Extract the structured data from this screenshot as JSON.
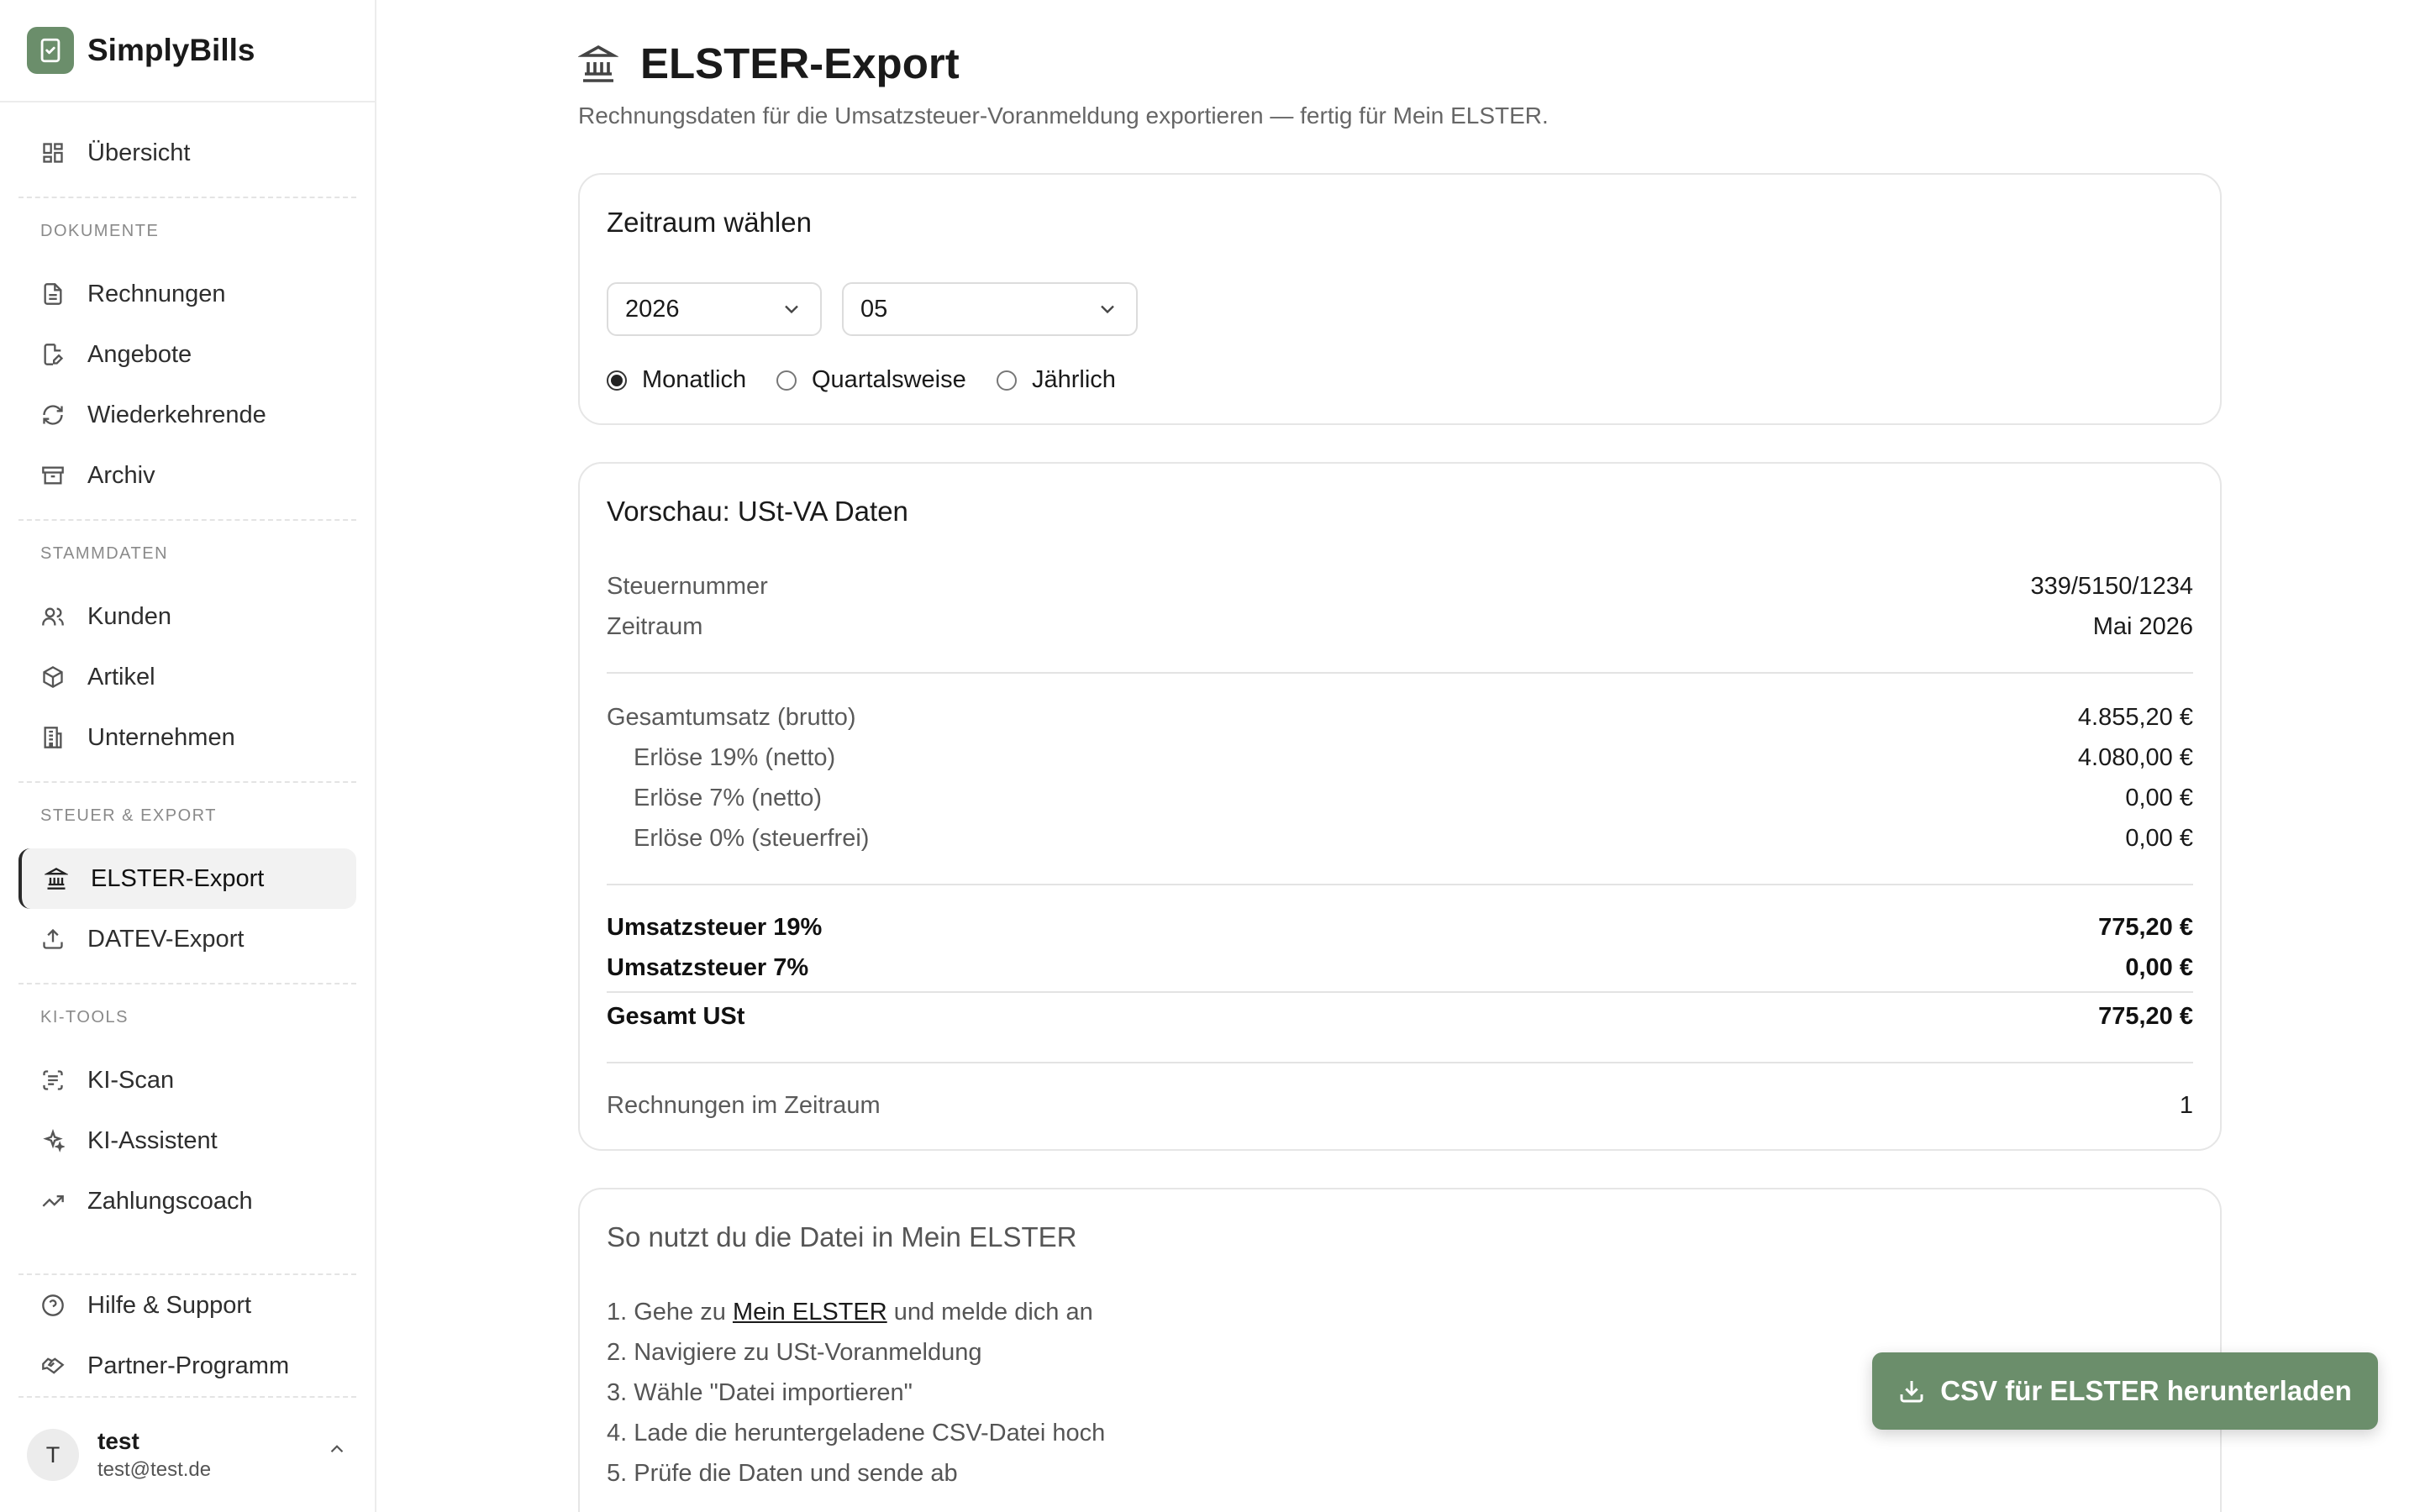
{
  "app": {
    "name": "SimplyBills"
  },
  "sidebar": {
    "overview": "Übersicht",
    "sections": {
      "documents": "DOKUMENTE",
      "masterdata": "STAMMDATEN",
      "tax": "STEUER & EXPORT",
      "ai": "KI-TOOLS"
    },
    "items": {
      "invoices": "Rechnungen",
      "offers": "Angebote",
      "recurring": "Wiederkehrende",
      "archive": "Archiv",
      "customers": "Kunden",
      "articles": "Artikel",
      "company": "Unternehmen",
      "elster": "ELSTER-Export",
      "datev": "DATEV-Export",
      "kiscan": "KI-Scan",
      "kiassistant": "KI-Assistent",
      "coach": "Zahlungscoach",
      "help": "Hilfe & Support",
      "partner": "Partner-Programm"
    },
    "user": {
      "initial": "T",
      "name": "test",
      "email": "test@test.de"
    }
  },
  "page": {
    "title": "ELSTER-Export",
    "subtitle": "Rechnungsdaten für die Umsatzsteuer-Voranmeldung exportieren — fertig für Mein ELSTER."
  },
  "period": {
    "title": "Zeitraum wählen",
    "year": "2026",
    "month": "05",
    "options": [
      "Monatlich",
      "Quartalsweise",
      "Jährlich"
    ],
    "selected": "Monatlich"
  },
  "preview": {
    "title": "Vorschau: USt-VA Daten",
    "tax_number_label": "Steuernummer",
    "tax_number": "339/5150/1234",
    "period_label": "Zeitraum",
    "period_value": "Mai 2026",
    "gross_label": "Gesamtumsatz (brutto)",
    "gross": "4.855,20 €",
    "rev19_label": "Erlöse 19% (netto)",
    "rev19": "4.080,00 €",
    "rev7_label": "Erlöse 7% (netto)",
    "rev7": "0,00 €",
    "rev0_label": "Erlöse 0% (steuerfrei)",
    "rev0": "0,00 €",
    "vat19_label": "Umsatzsteuer 19%",
    "vat19": "775,20 €",
    "vat7_label": "Umsatzsteuer 7%",
    "vat7": "0,00 €",
    "total_label": "Gesamt USt",
    "total": "775,20 €",
    "count_label": "Rechnungen im Zeitraum",
    "count": "1"
  },
  "howto": {
    "title": "So nutzt du die Datei in Mein ELSTER",
    "step1_a": "1. Gehe zu ",
    "step1_link": "Mein ELSTER",
    "step1_b": " und melde dich an",
    "step2": "2. Navigiere zu USt-Voranmeldung",
    "step3": "3. Wähle \"Datei importieren\"",
    "step4": "4. Lade die heruntergeladene CSV-Datei hoch",
    "step5": "5. Prüfe die Daten und sende ab"
  },
  "cta": {
    "label": "CSV für ELSTER herunterladen"
  },
  "colors": {
    "accent": "#6b8e6b"
  }
}
